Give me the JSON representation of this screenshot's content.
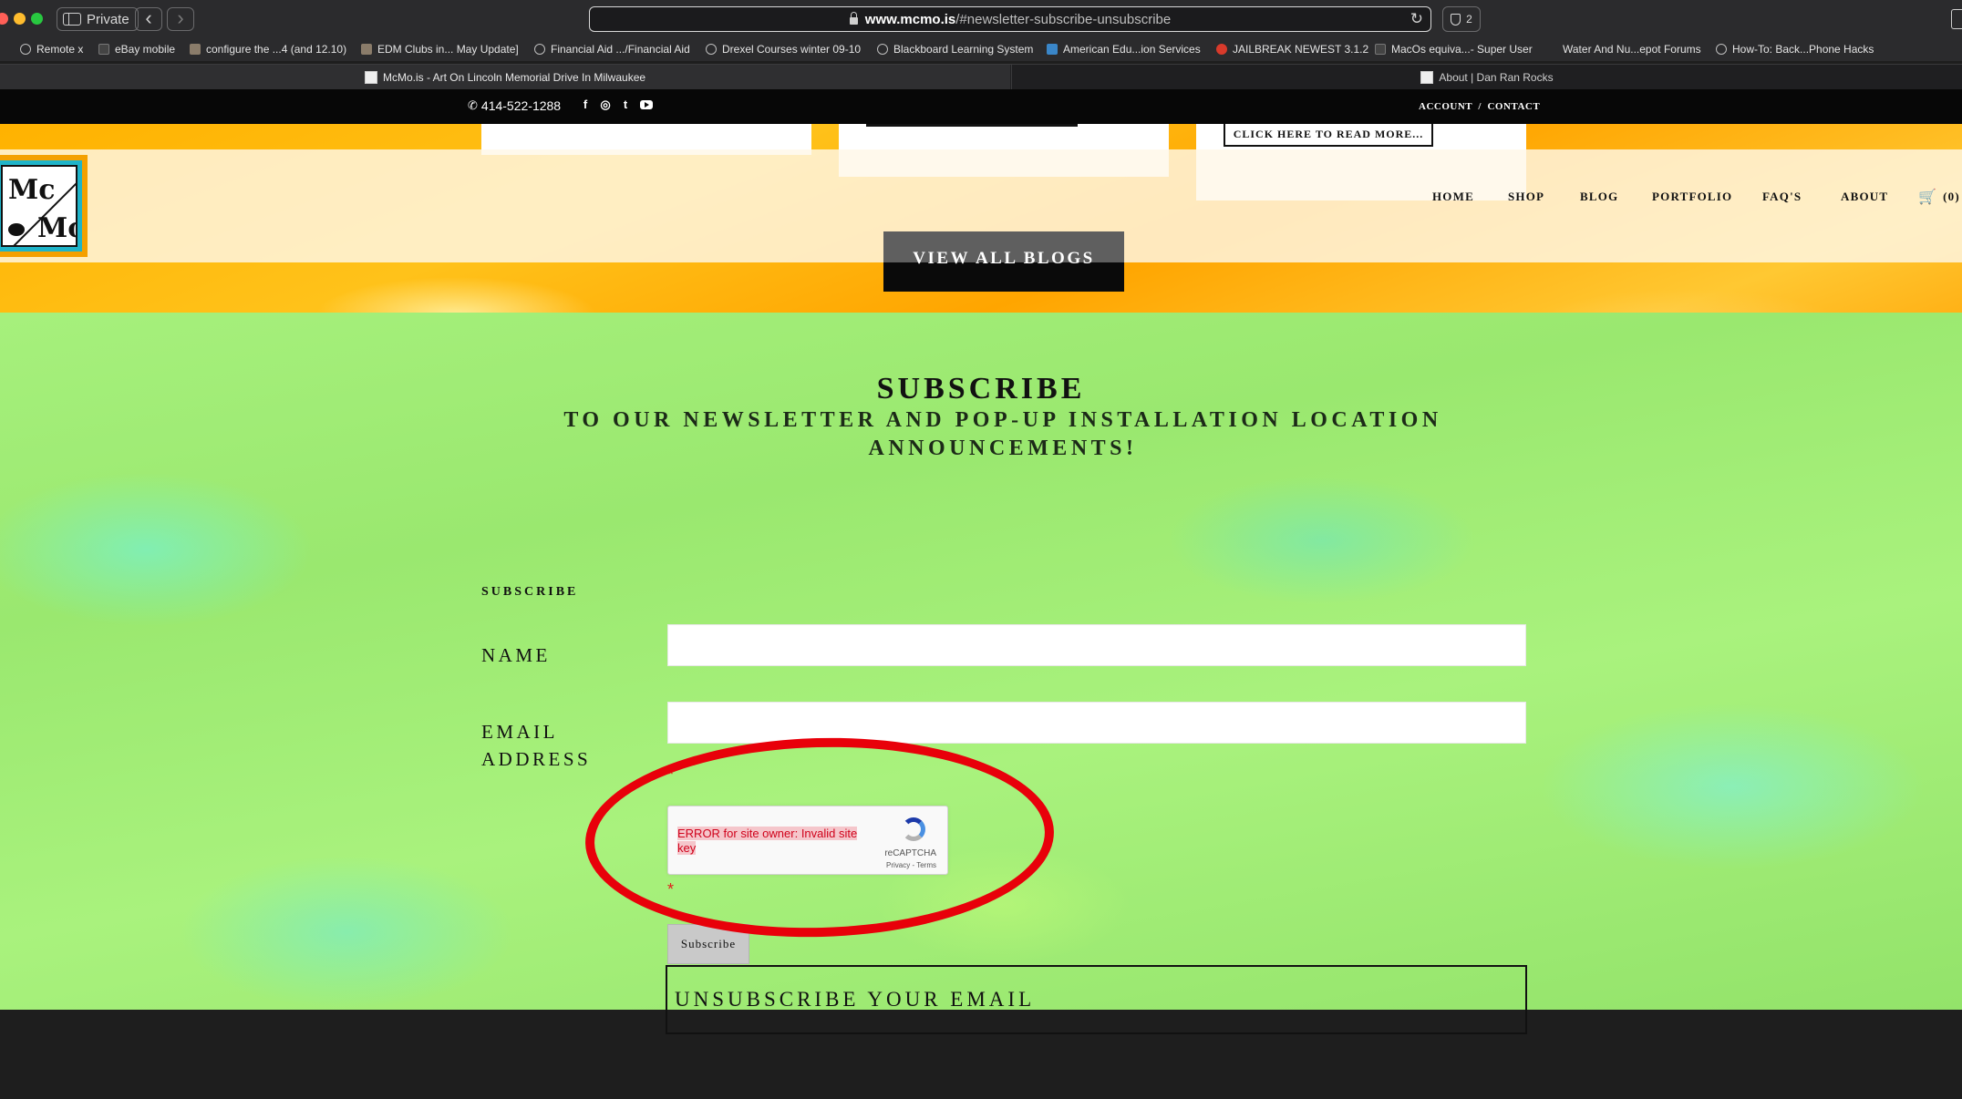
{
  "browser": {
    "private_label": "Private",
    "url_host": "www.mcmo.is",
    "url_path": "/#newsletter-subscribe-unsubscribe",
    "extension_count": "2",
    "bookmarks": [
      "Remote x",
      "eBay mobile",
      "configure the ...4 (and 12.10)",
      "EDM Clubs in... May Update]",
      "Financial Aid .../Financial Aid",
      "Drexel Courses winter 09-10",
      "Blackboard Learning System",
      "American Edu...ion Services",
      "JAILBREAK NEWEST 3.1.2",
      "MacOs equiva...- Super User",
      "Water And Nu...epot Forums",
      "How-To: Back...Phone Hacks"
    ],
    "tabs": [
      "McMo.is - Art On Lincoln Memorial Drive In Milwaukee",
      "About | Dan Ran Rocks"
    ]
  },
  "topbar": {
    "phone": "414-522-1288",
    "social": [
      "f",
      "◎",
      "t",
      "yt"
    ],
    "account": "ACCOUNT",
    "separator": "/",
    "contact": "CONTACT"
  },
  "blog": {
    "read_more": "CLICK HERE TO READ MORE...",
    "view_all": "VIEW ALL BLOGS"
  },
  "logo": {
    "line1": "Mc",
    "line2": "Mo"
  },
  "nav": {
    "items": [
      "HOME",
      "SHOP",
      "BLOG",
      "PORTFOLIO",
      "FAQ'S",
      "ABOUT"
    ],
    "cart": "(0) I"
  },
  "subscribe": {
    "title": "SUBSCRIBE",
    "subtitle": "TO OUR NEWSLETTER AND POP-UP INSTALLATION LOCATION ANNOUNCEMENTS!",
    "form_label": "SUBSCRIBE",
    "name_label": "NAME",
    "email_label": "EMAIL ADDRESS",
    "required_mark": "*",
    "recaptcha_error": "ERROR for site owner: Invalid site key",
    "recaptcha_brand": "reCAPTCHA",
    "recaptcha_links": "Privacy - Terms",
    "button": "Subscribe",
    "unsubscribe": "UNSUBSCRIBE YOUR EMAIL"
  },
  "colors": {
    "annotation": "#e8000a",
    "error_text": "#d0021b",
    "orange_bg": "#ffb200",
    "green_bg": "#a6f07c"
  }
}
